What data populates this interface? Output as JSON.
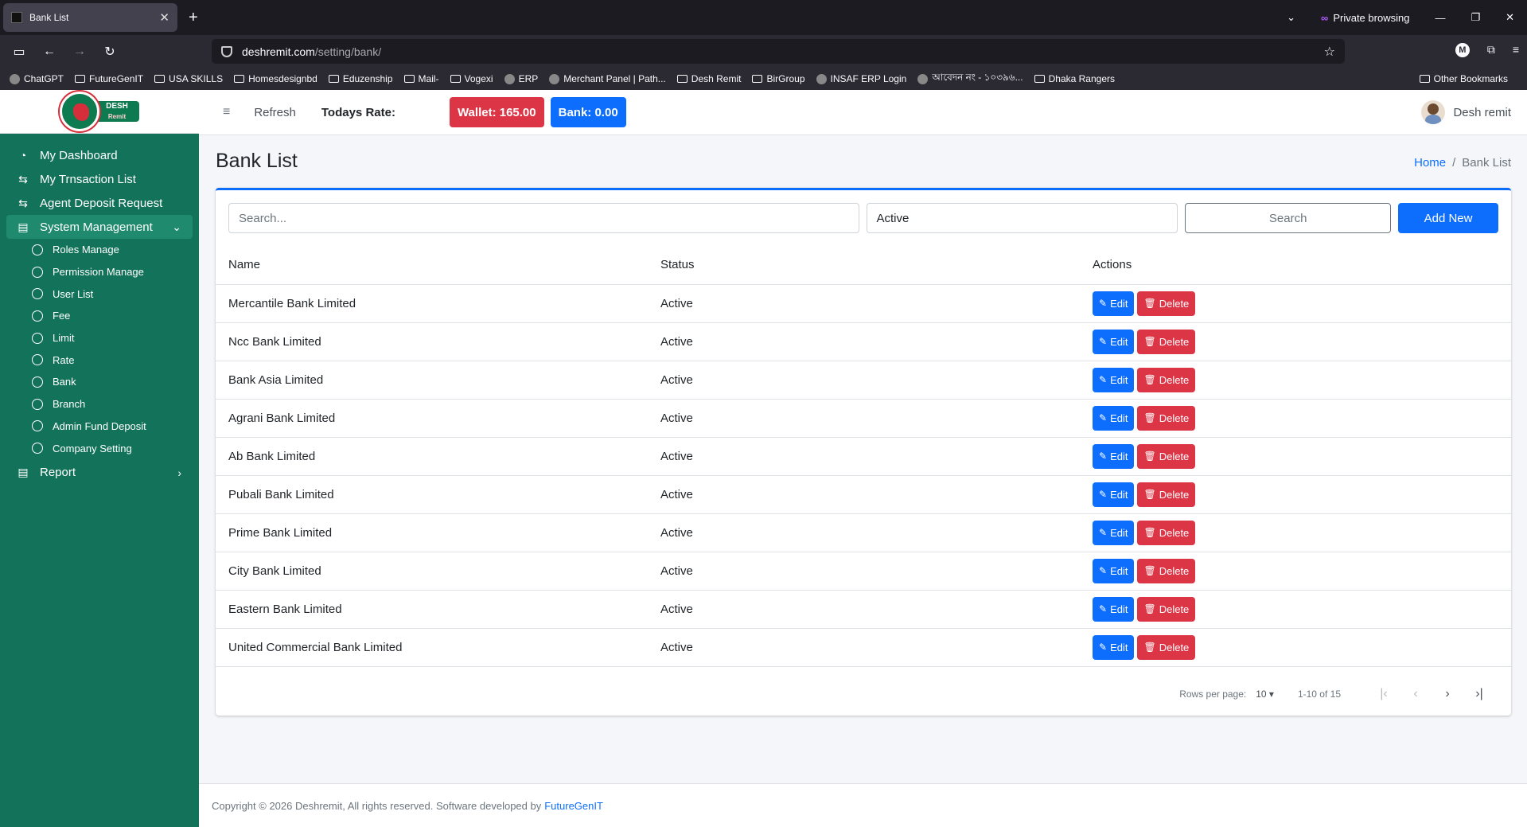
{
  "browser": {
    "tab_title": "Bank List",
    "new_tab": "+",
    "private_label": "Private browsing",
    "url_host": "deshremit.com",
    "url_path": "/setting/bank/",
    "bookmarks": [
      {
        "label": "ChatGPT",
        "type": "site"
      },
      {
        "label": "FutureGenIT",
        "type": "folder"
      },
      {
        "label": "USA SKILLS",
        "type": "folder"
      },
      {
        "label": "Homesdesignbd",
        "type": "folder"
      },
      {
        "label": "Eduzenship",
        "type": "folder"
      },
      {
        "label": "Mail-",
        "type": "folder"
      },
      {
        "label": "Vogexi",
        "type": "folder"
      },
      {
        "label": "ERP",
        "type": "site"
      },
      {
        "label": "Merchant Panel | Path...",
        "type": "site"
      },
      {
        "label": "Desh Remit",
        "type": "folder"
      },
      {
        "label": "BirGroup",
        "type": "folder"
      },
      {
        "label": "INSAF ERP Login",
        "type": "site"
      },
      {
        "label": "আবেদন নং - ১০৩৯৬...",
        "type": "site"
      },
      {
        "label": "Dhaka Rangers",
        "type": "folder"
      }
    ],
    "other_bookmarks": "Other Bookmarks"
  },
  "logo": {
    "top": "DESH",
    "bottom": "Remit"
  },
  "sidebar": {
    "items": [
      {
        "label": "My Dashboard",
        "icon": "dashboard-icon"
      },
      {
        "label": "My Trnsaction List",
        "icon": "exchange-icon"
      },
      {
        "label": "Agent Deposit Request",
        "icon": "exchange-icon"
      },
      {
        "label": "System Management",
        "icon": "clipboard-icon"
      }
    ],
    "sub_items": [
      "Roles Manage",
      "Permission Manage",
      "User List",
      "Fee",
      "Limit",
      "Rate",
      "Bank",
      "Branch",
      "Admin Fund Deposit",
      "Company Setting"
    ],
    "report": "Report"
  },
  "header": {
    "refresh": "Refresh",
    "todays_rate": "Todays Rate:",
    "wallet": "Wallet: 165.00",
    "bank": "Bank: 0.00",
    "user_name": "Desh remit"
  },
  "page": {
    "title": "Bank List",
    "breadcrumb_home": "Home",
    "breadcrumb_sep": "/",
    "breadcrumb_current": "Bank List"
  },
  "filters": {
    "search_placeholder": "Search...",
    "status_value": "Active",
    "search_button": "Search",
    "add_button": "Add New"
  },
  "table": {
    "columns": [
      "Name",
      "Status",
      "Actions"
    ],
    "rows": [
      {
        "name": "Mercantile Bank Limited",
        "status": "Active"
      },
      {
        "name": "Ncc Bank Limited",
        "status": "Active"
      },
      {
        "name": "Bank Asia Limited",
        "status": "Active"
      },
      {
        "name": "Agrani Bank Limited",
        "status": "Active"
      },
      {
        "name": "Ab Bank Limited",
        "status": "Active"
      },
      {
        "name": "Pubali Bank Limited",
        "status": "Active"
      },
      {
        "name": "Prime Bank Limited",
        "status": "Active"
      },
      {
        "name": "City Bank Limited",
        "status": "Active"
      },
      {
        "name": "Eastern Bank Limited",
        "status": "Active"
      },
      {
        "name": "United Commercial Bank Limited",
        "status": "Active"
      }
    ],
    "edit_label": "Edit",
    "delete_label": "Delete"
  },
  "pagination": {
    "rows_per_page_label": "Rows per page:",
    "rows_per_page": "10",
    "range": "1-10 of 15"
  },
  "footer": {
    "text": "Copyright © 2026 Deshremit, All rights reserved. Software developed by",
    "link": "FutureGenIT"
  },
  "colors": {
    "sidebar": "#13735a",
    "primary": "#0d6efd",
    "danger": "#dc3545"
  }
}
